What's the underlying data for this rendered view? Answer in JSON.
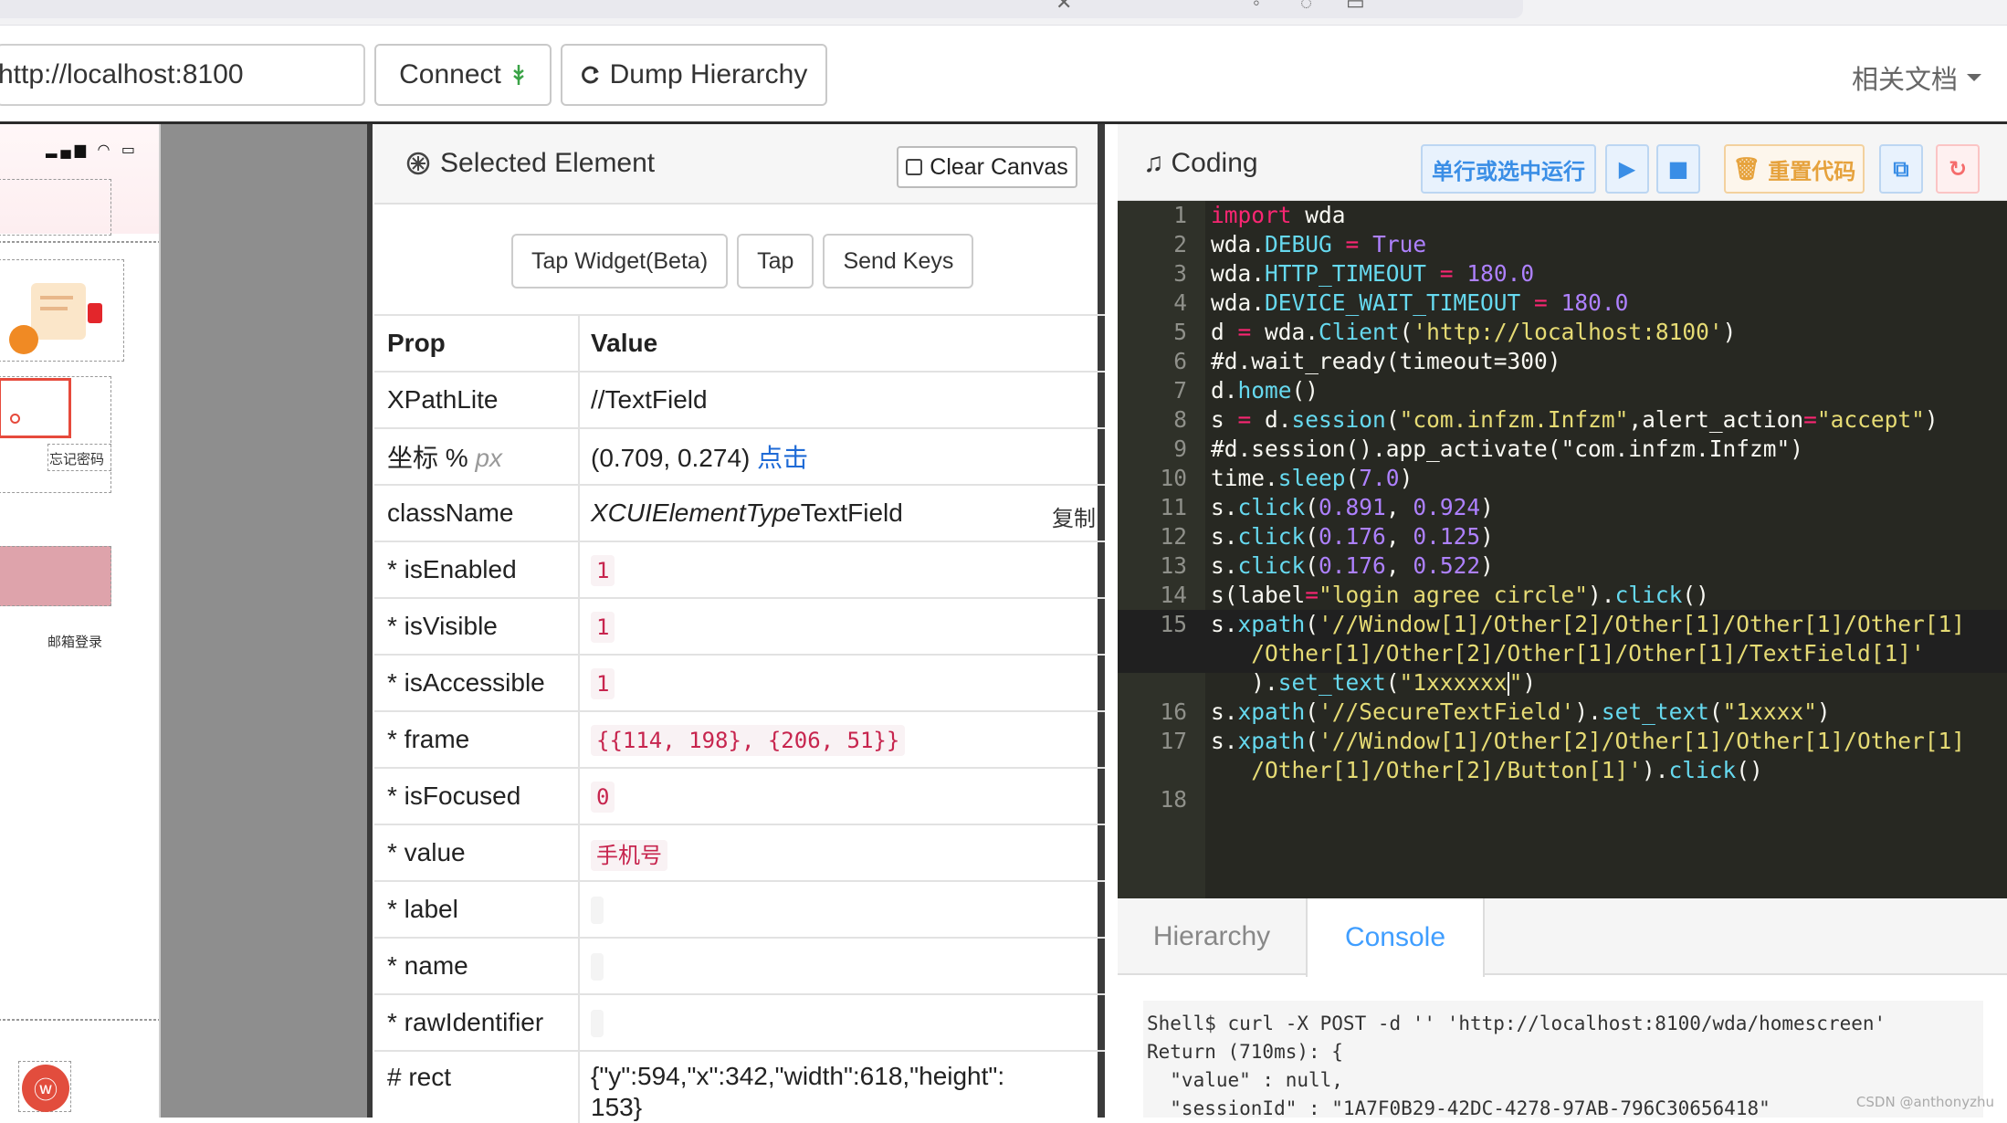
{
  "toolbar": {
    "url_value": "http://localhost:8100",
    "connect_label": "Connect",
    "dump_label": "Dump Hierarchy",
    "docs_label": "相关文档"
  },
  "phone": {
    "forgot_password": "忘记密码",
    "email_login": "邮箱登录"
  },
  "selected": {
    "title": "Selected Element",
    "clear_canvas": "Clear Canvas",
    "actions": [
      "Tap Widget(Beta)",
      "Tap",
      "Send Keys"
    ],
    "header_prop": "Prop",
    "header_value": "Value",
    "rows": {
      "xpath": {
        "k": "XPathLite",
        "v": "//TextField"
      },
      "coord": {
        "k": "坐标 %",
        "k_unit": "px",
        "v": "(0.709, 0.274)",
        "link": "点击"
      },
      "class": {
        "k": "className",
        "v_italic": "XCUIElementType",
        "v_rest": "TextField",
        "copy": "复制"
      },
      "enabled": {
        "k": "* isEnabled",
        "v": "1"
      },
      "visible": {
        "k": "* isVisible",
        "v": "1"
      },
      "accessible": {
        "k": "* isAccessible",
        "v": "1"
      },
      "frame": {
        "k": "* frame",
        "v": "{{114, 198}, {206, 51}}"
      },
      "focused": {
        "k": "* isFocused",
        "v": "0"
      },
      "value": {
        "k": "* value",
        "v": "手机号"
      },
      "label": {
        "k": "* label",
        "v": ""
      },
      "name": {
        "k": "* name",
        "v": ""
      },
      "raw": {
        "k": "* rawIdentifier",
        "v": ""
      },
      "rect": {
        "k": "# rect",
        "v": "{\"y\":594,\"x\":342,\"width\":618,\"height\":",
        "v2": "153}"
      }
    }
  },
  "coding": {
    "title": "Coding",
    "run_line": "单行或选中运行",
    "reset": "重置代码"
  },
  "code_lines": {
    "n": [
      "1",
      "2",
      "3",
      "4",
      "5",
      "6",
      "7",
      "8",
      "9",
      "10",
      "11",
      "12",
      "13",
      "14",
      "15",
      "16",
      "17",
      "18"
    ]
  },
  "tabs": {
    "hierarchy": "Hierarchy",
    "console": "Console"
  },
  "console_text": "Shell$ curl -X POST -d '' 'http://localhost:8100/wda/homescreen'\nReturn (710ms): {\n  \"value\" : null,\n  \"sessionId\" : \"1A7F0B29-42DC-4278-97AB-796C30656418\"",
  "watermark": "CSDN @anthonyzhu",
  "colors": {
    "keyword": "#f92672",
    "number": "#ae81ff",
    "string": "#e6db74",
    "function": "#66d9ef",
    "comment": "#75715e",
    "link": "#1e6ad6",
    "accent": "#409eff"
  }
}
